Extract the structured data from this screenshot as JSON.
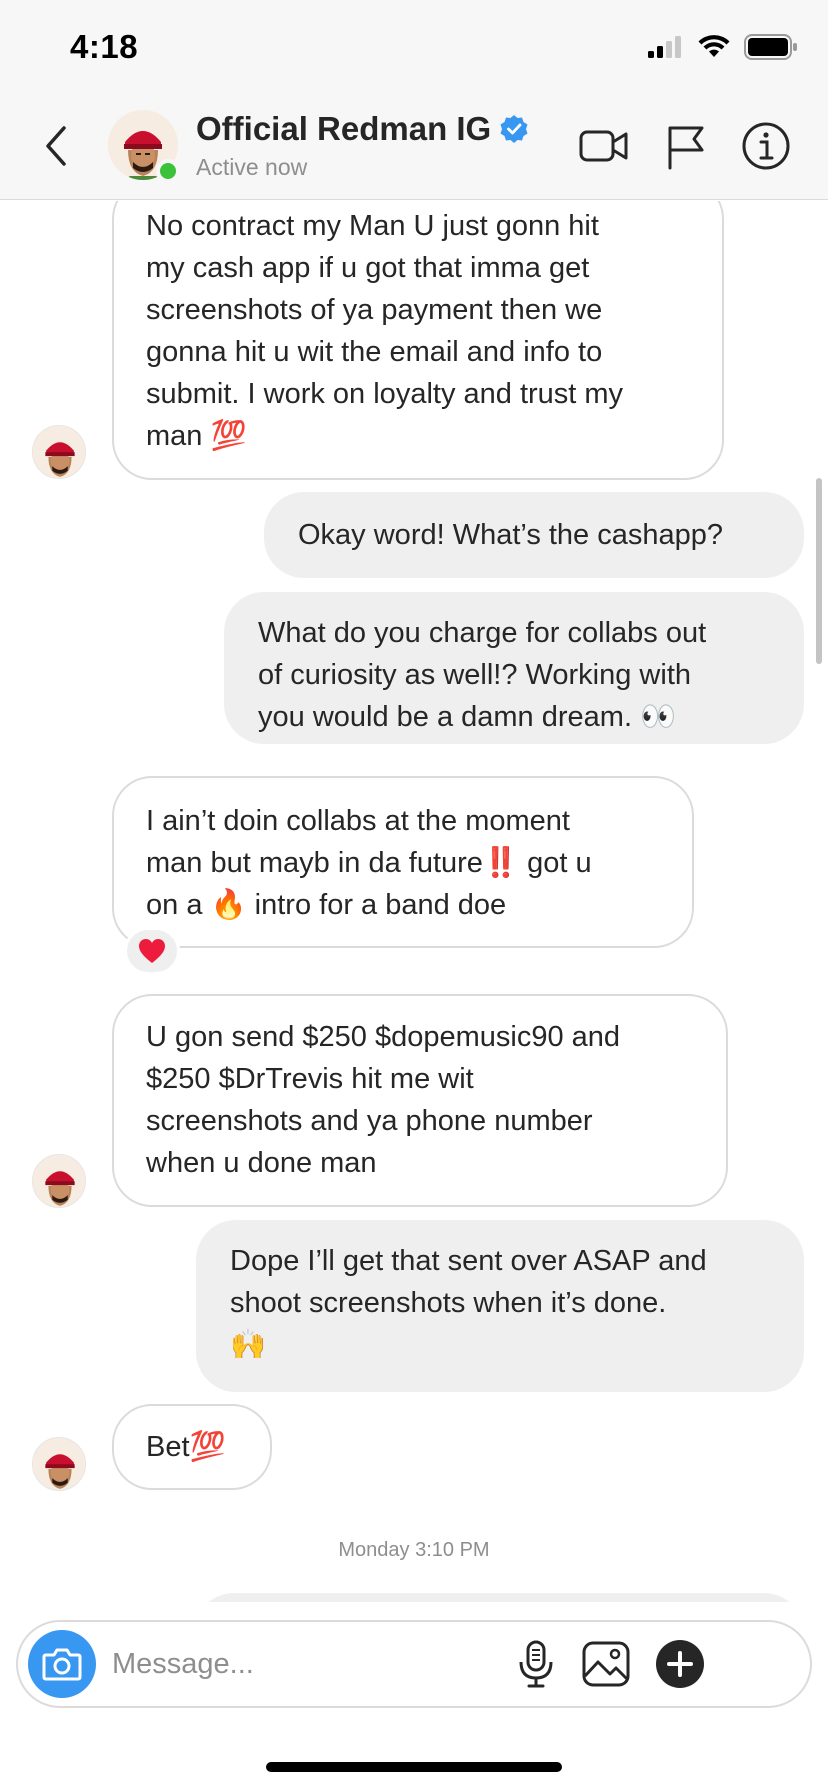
{
  "status_bar": {
    "time": "4:18"
  },
  "header": {
    "name": "Official Redman IG",
    "status": "Active now",
    "verified": true
  },
  "messages": [
    {
      "direction": "in",
      "text": "No contract my Man U just gonn hit\nmy cash app if u got that imma get\nscreenshots of ya payment then we\ngonna hit u wit the email and info to\nsubmit. I work on loyalty and trust my\nman 💯",
      "avatar": true
    },
    {
      "direction": "out",
      "text": "Okay word! What’s the cashapp?"
    },
    {
      "direction": "out",
      "text": "What do you charge for collabs out\nof curiosity as well!? Working with\nyou would be a damn dream. 👀"
    },
    {
      "direction": "in",
      "text": "I ain’t doin collabs at the moment\nman but mayb in da future‼️ got u\non a 🔥 intro for a band doe",
      "reaction": "❤️"
    },
    {
      "direction": "in",
      "text": "U gon send $250 $dopemusic90 and\n$250 $DrTrevis hit me wit\nscreenshots and ya phone number\nwhen u done man",
      "avatar": true
    },
    {
      "direction": "out",
      "text": "Dope I’ll get that sent over ASAP and\nshoot screenshots when it’s done.\n🙌"
    },
    {
      "direction": "in",
      "text": "Bet💯",
      "avatar": true
    }
  ],
  "timestamp": "Monday 3:10 PM",
  "composer": {
    "placeholder": "Message..."
  },
  "colors": {
    "accent": "#3897f0",
    "online": "#3cc13b",
    "verified": "#3897f0",
    "outgoing_bubble": "#efefef"
  },
  "icons": [
    "back-icon",
    "video-call-icon",
    "flag-icon",
    "info-icon",
    "camera-icon",
    "microphone-icon",
    "gallery-icon",
    "plus-icon"
  ]
}
